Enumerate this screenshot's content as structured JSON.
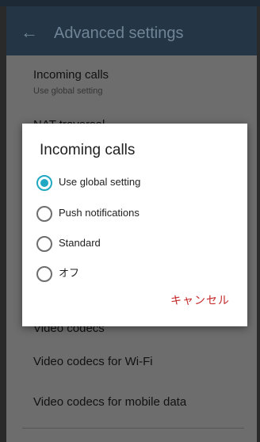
{
  "appbar": {
    "back_icon": "back-arrow-icon",
    "title": "Advanced settings"
  },
  "settings": [
    {
      "title": "Incoming calls",
      "subtitle": "Use global setting"
    },
    {
      "title": "NAT traversal"
    },
    {
      "title": "Video codecs"
    },
    {
      "title": "Video codecs for Wi-Fi"
    },
    {
      "title": "Video codecs for mobile data"
    }
  ],
  "dialog": {
    "title": "Incoming calls",
    "options": [
      {
        "label": "Use global setting",
        "selected": true
      },
      {
        "label": "Push notifications",
        "selected": false
      },
      {
        "label": "Standard",
        "selected": false
      },
      {
        "label": "オフ",
        "selected": false
      }
    ],
    "cancel_label": "キャンセル"
  },
  "colors": {
    "appbar_bg": "#243545",
    "scrim_bg": "#6d6d6d",
    "radio_accent": "#21a8c2",
    "cancel_text": "#c62828"
  }
}
